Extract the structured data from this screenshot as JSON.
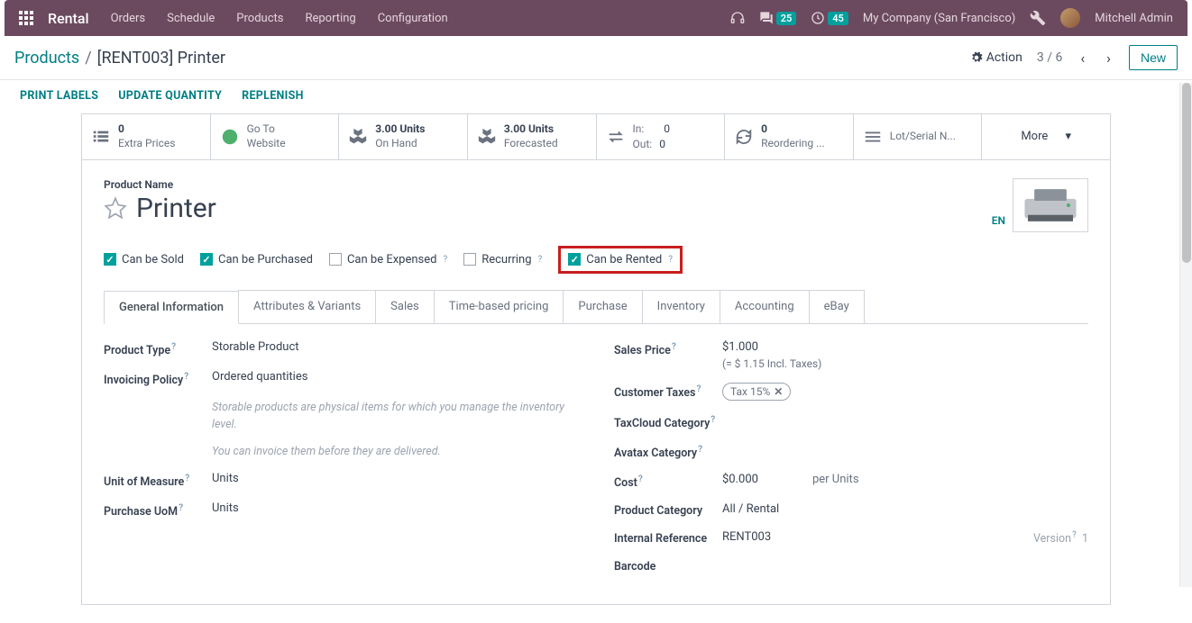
{
  "topnav": {
    "app": "Rental",
    "links": [
      "Orders",
      "Schedule",
      "Products",
      "Reporting",
      "Configuration"
    ],
    "chat_badge": "25",
    "clock_badge": "45",
    "company": "My Company (San Francisco)",
    "user": "Mitchell Admin"
  },
  "breadcrumb": {
    "root": "Products",
    "current": "[RENT003] Printer",
    "action": "Action",
    "pager": "3 / 6",
    "new": "New"
  },
  "actions": {
    "print": "PRINT LABELS",
    "update": "UPDATE QUANTITY",
    "replenish": "REPLENISH"
  },
  "stats": {
    "extra_n": "0",
    "extra_l": "Extra Prices",
    "website": "Go To Website",
    "onhand_n": "3.00 Units",
    "onhand_l": "On Hand",
    "forecast_n": "3.00 Units",
    "forecast_l": "Forecasted",
    "in_l": "In:",
    "in_v": "0",
    "out_l": "Out:",
    "out_v": "0",
    "reorder_n": "0",
    "reorder_l": "Reordering ...",
    "lot": "Lot/Serial N...",
    "more": "More"
  },
  "form": {
    "name_label": "Product Name",
    "name": "Printer",
    "lang": "EN",
    "checks": {
      "sold": "Can be Sold",
      "purchased": "Can be Purchased",
      "expensed": "Can be Expensed",
      "recurring": "Recurring",
      "rented": "Can be Rented"
    },
    "tabs": [
      "General Information",
      "Attributes & Variants",
      "Sales",
      "Time-based pricing",
      "Purchase",
      "Inventory",
      "Accounting",
      "eBay"
    ],
    "fields": {
      "product_type_l": "Product Type",
      "product_type_v": "Storable Product",
      "invoicing_l": "Invoicing Policy",
      "invoicing_v": "Ordered quantities",
      "note1": "Storable products are physical items for which you manage the inventory level.",
      "note2": "You can invoice them before they are delivered.",
      "uom_l": "Unit of Measure",
      "uom_v": "Units",
      "puom_l": "Purchase UoM",
      "puom_v": "Units",
      "price_l": "Sales Price",
      "price_v": "$1.000",
      "price_incl": "(= $ 1.15 Incl. Taxes)",
      "tax_l": "Customer Taxes",
      "tax_v": "Tax 15%",
      "taxcloud_l": "TaxCloud Category",
      "avatax_l": "Avatax Category",
      "cost_l": "Cost",
      "cost_v": "$0.000",
      "cost_per": "per Units",
      "cat_l": "Product Category",
      "cat_v": "All / Rental",
      "ref_l": "Internal Reference",
      "ref_v": "RENT003",
      "ver_l": "Version",
      "ver_v": "1",
      "barcode_l": "Barcode"
    }
  }
}
